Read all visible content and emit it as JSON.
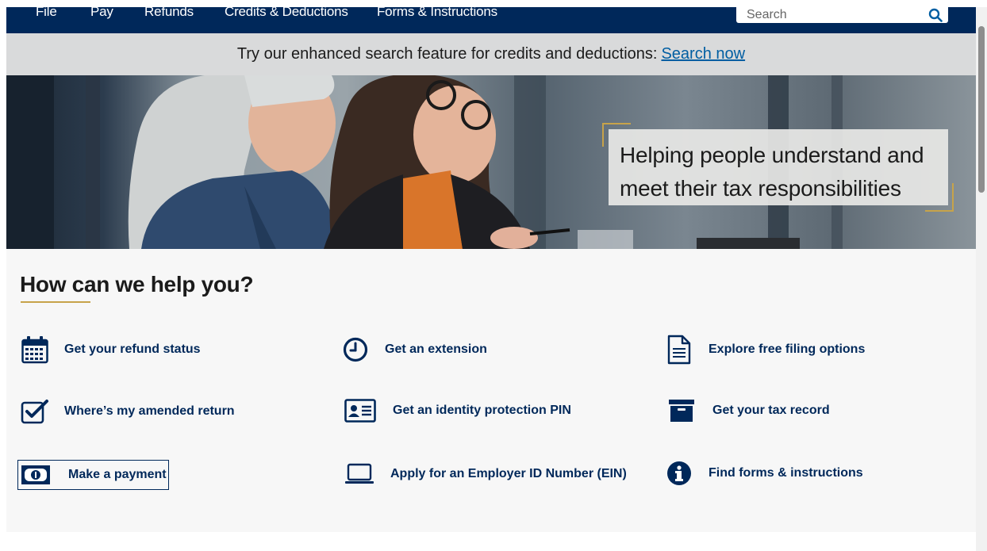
{
  "nav": {
    "items": [
      "File",
      "Pay",
      "Refunds",
      "Credits & Deductions",
      "Forms & Instructions"
    ],
    "search_placeholder": "Search"
  },
  "banner": {
    "text": "Try our enhanced search feature for credits and deductions:",
    "link": "Search now"
  },
  "hero": {
    "line1": "Helping people understand and",
    "line2": "meet their tax responsibilities"
  },
  "help": {
    "title": "How can we help you?",
    "links": [
      {
        "label": "Get your refund status",
        "icon": "calendar-icon"
      },
      {
        "label": "Get an extension",
        "icon": "clock-icon"
      },
      {
        "label": "Explore free filing options",
        "icon": "document-icon"
      },
      {
        "label": "Where’s my amended return",
        "icon": "checkbox-icon"
      },
      {
        "label": "Get an identity protection PIN",
        "icon": "id-card-icon"
      },
      {
        "label": "Get your tax record",
        "icon": "archive-box-icon"
      },
      {
        "label": "Make a payment",
        "icon": "money-icon"
      },
      {
        "label": "Apply for an Employer ID Number (EIN)",
        "icon": "laptop-icon"
      },
      {
        "label": "Find forms & instructions",
        "icon": "info-icon"
      }
    ]
  },
  "colors": {
    "navy": "#00285a",
    "gold": "#c7a34a",
    "link_blue": "#005ea2"
  }
}
